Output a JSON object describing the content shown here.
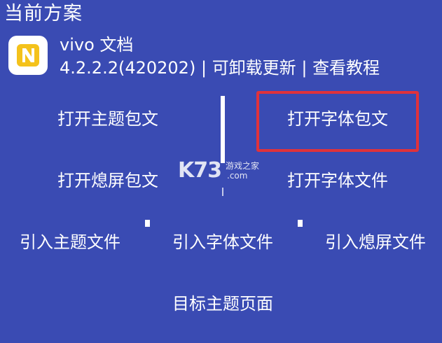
{
  "section_title": "当前方案",
  "app": {
    "name": "vivo 文档",
    "version": "4.2.2.2(420202)",
    "separator": "|",
    "uninstall_update": "可卸载更新",
    "tutorial": "查看教程",
    "icon": "vivo-docs-app-icon",
    "icon_color": "#f4c21b"
  },
  "actions": {
    "open_theme_package": "打开主题包文",
    "open_font_package": "打开字体包文",
    "open_screen_off_package": "打开熄屏包文",
    "open_font_file": "打开字体文件",
    "import_theme_file": "引入主题文件",
    "import_font_file": "引入字体文件",
    "import_screen_off_file": "引入熄屏文件",
    "target_theme_page": "目标主题页面"
  },
  "watermark": {
    "brand": "K73",
    "cn": "游戏之家",
    "domain": ".com"
  },
  "colors": {
    "background": "#3a4bb3",
    "highlight": "#e0323b",
    "text": "#ffffff"
  }
}
